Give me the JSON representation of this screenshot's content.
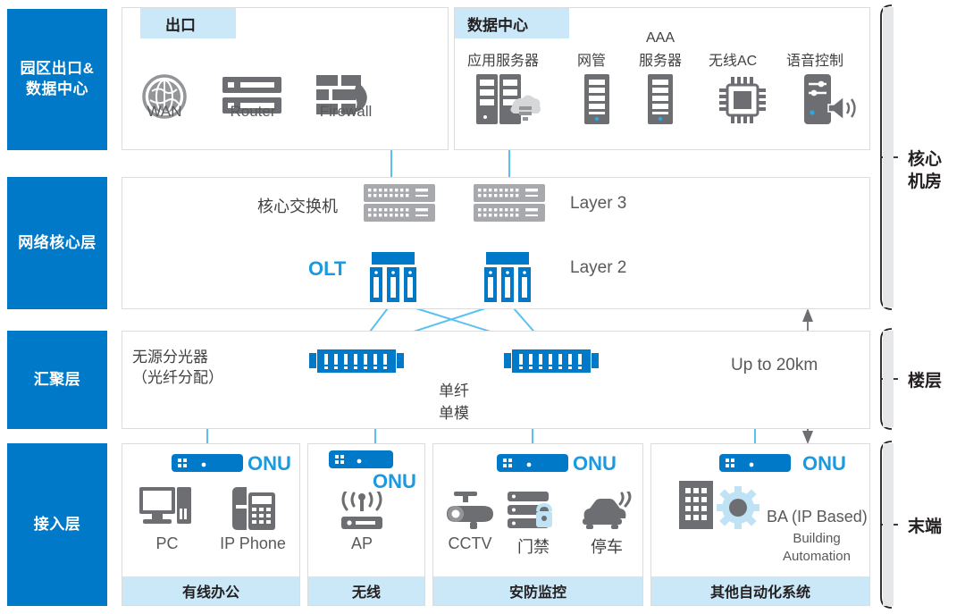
{
  "tiers": [
    {
      "id": "campus-egress-dc",
      "label": "园区出口&\n数据中心"
    },
    {
      "id": "network-core",
      "label": "网络核心层"
    },
    {
      "id": "aggregation",
      "label": "汇聚层"
    },
    {
      "id": "access",
      "label": "接入层"
    }
  ],
  "tier_labels": {
    "t1_line1": "园区出口&",
    "t1_line2": "数据中心",
    "t2": "网络核心层",
    "t3": "汇聚层",
    "t4": "接入层"
  },
  "egress": {
    "header": "出口",
    "nodes": [
      {
        "name": "WAN",
        "label": "WAN",
        "icon": "globe-icon"
      },
      {
        "name": "Router",
        "label": "Router",
        "icon": "router-icon"
      },
      {
        "name": "Firewall",
        "label": "Firewall",
        "icon": "firewall-icon"
      }
    ]
  },
  "datacenter": {
    "header": "数据中心",
    "nodes": [
      {
        "label": "应用服务器",
        "icon": "app-server-icon"
      },
      {
        "label": "网管",
        "icon": "nms-server-icon"
      },
      {
        "label_line1": "AAA",
        "label_line2": "服务器",
        "icon": "aaa-server-icon"
      },
      {
        "label": "无线AC",
        "icon": "wireless-ac-chip-icon"
      },
      {
        "label": "语音控制",
        "icon": "voice-control-icon"
      }
    ]
  },
  "core": {
    "switch_label": "核心交换机",
    "olt_label": "OLT",
    "layer3": "Layer 3",
    "layer2": "Layer 2"
  },
  "aggregation": {
    "splitter_line1": "无源分光器",
    "splitter_line2": "（光纤分配）",
    "fiber_line1": "单纤",
    "fiber_line2": "单模",
    "distance": "Up to 20km"
  },
  "access": {
    "onu_label": "ONU",
    "groups": [
      {
        "footer": "有线办公",
        "devices": [
          {
            "label": "PC",
            "icon": "desktop-pc-icon"
          },
          {
            "label": "IP Phone",
            "icon": "ip-phone-icon"
          }
        ]
      },
      {
        "footer": "无线",
        "devices": [
          {
            "label": "AP",
            "icon": "wireless-ap-icon"
          }
        ]
      },
      {
        "footer": "安防监控",
        "devices": [
          {
            "label": "CCTV",
            "icon": "cctv-camera-icon"
          },
          {
            "label": "门禁",
            "icon": "access-control-icon"
          },
          {
            "label": "停车",
            "icon": "parking-car-icon"
          }
        ]
      },
      {
        "footer": "其他自动化系统",
        "devices": [
          {
            "label": "BA (IP Based)",
            "sub_line1": "Building",
            "sub_line2": "Automation",
            "icon": "building-automation-icon"
          }
        ]
      }
    ]
  },
  "brackets": [
    {
      "label_line1": "核心",
      "label_line2": "机房"
    },
    {
      "label_line1": "楼层",
      "label_line2": ""
    },
    {
      "label_line1": "末端",
      "label_line2": ""
    }
  ],
  "colors": {
    "tier_blue": "#0079c8",
    "header_blue": "#cbe8f8",
    "link_blue": "#5bc0f0",
    "accent_blue": "#1b9ae0",
    "device_grey": "#6d6e71",
    "panel_border": "#dcdcdc"
  }
}
